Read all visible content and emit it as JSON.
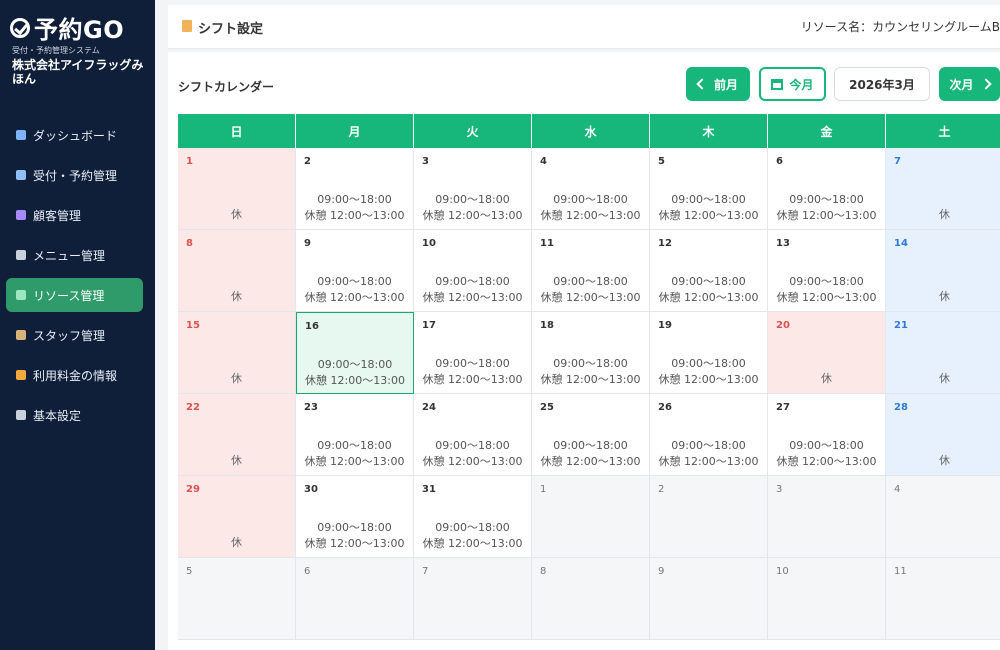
{
  "app": {
    "logo_text": "予約GO",
    "logo_sub": "受付・予約管理システム",
    "company": "株式会社アイフラッグみほん"
  },
  "sidebar": {
    "items": [
      {
        "label": "ダッシュボード",
        "icon": "chart-icon",
        "active": false
      },
      {
        "label": "受付・予約管理",
        "icon": "calendar-icon",
        "active": false
      },
      {
        "label": "顧客管理",
        "icon": "users-icon",
        "active": false
      },
      {
        "label": "メニュー管理",
        "icon": "tools-icon",
        "active": false
      },
      {
        "label": "リソース管理",
        "icon": "resource-icon",
        "active": true
      },
      {
        "label": "スタッフ管理",
        "icon": "staff-icon",
        "active": false
      },
      {
        "label": "利用料金の情報",
        "icon": "money-bag-icon",
        "active": false
      },
      {
        "label": "基本設定",
        "icon": "gear-icon",
        "active": false
      }
    ]
  },
  "header": {
    "title": "シフト設定",
    "resource": "リソース名：カウンセリングルームB"
  },
  "panel": {
    "title": "シフトカレンダー",
    "prev_label": "前月",
    "today_label": "今月",
    "current_month": "2026年3月",
    "next_label": "次月"
  },
  "calendar": {
    "weekdays": [
      "日",
      "月",
      "火",
      "水",
      "木",
      "金",
      "土"
    ],
    "work_time": "09:00〜18:00",
    "break_time": "休憩 12:00〜13:00",
    "off_label": "休",
    "cells": [
      {
        "day": "1",
        "type": "sun-off"
      },
      {
        "day": "2",
        "type": "work"
      },
      {
        "day": "3",
        "type": "work"
      },
      {
        "day": "4",
        "type": "work"
      },
      {
        "day": "5",
        "type": "work"
      },
      {
        "day": "6",
        "type": "work"
      },
      {
        "day": "7",
        "type": "sat-off"
      },
      {
        "day": "8",
        "type": "sun-off"
      },
      {
        "day": "9",
        "type": "work"
      },
      {
        "day": "10",
        "type": "work"
      },
      {
        "day": "11",
        "type": "work"
      },
      {
        "day": "12",
        "type": "work"
      },
      {
        "day": "13",
        "type": "work"
      },
      {
        "day": "14",
        "type": "sat-off"
      },
      {
        "day": "15",
        "type": "sun-off"
      },
      {
        "day": "16",
        "type": "today"
      },
      {
        "day": "17",
        "type": "work"
      },
      {
        "day": "18",
        "type": "work"
      },
      {
        "day": "19",
        "type": "work"
      },
      {
        "day": "20",
        "type": "off-pink"
      },
      {
        "day": "21",
        "type": "sat-off"
      },
      {
        "day": "22",
        "type": "sun-off"
      },
      {
        "day": "23",
        "type": "work"
      },
      {
        "day": "24",
        "type": "work"
      },
      {
        "day": "25",
        "type": "work"
      },
      {
        "day": "26",
        "type": "work"
      },
      {
        "day": "27",
        "type": "work"
      },
      {
        "day": "28",
        "type": "sat-off"
      },
      {
        "day": "29",
        "type": "sun-off"
      },
      {
        "day": "30",
        "type": "work"
      },
      {
        "day": "31",
        "type": "work"
      },
      {
        "day": "1",
        "type": "outside"
      },
      {
        "day": "2",
        "type": "outside"
      },
      {
        "day": "3",
        "type": "outside"
      },
      {
        "day": "4",
        "type": "outside"
      },
      {
        "day": "5",
        "type": "outside"
      },
      {
        "day": "6",
        "type": "outside"
      },
      {
        "day": "7",
        "type": "outside"
      },
      {
        "day": "8",
        "type": "outside"
      },
      {
        "day": "9",
        "type": "outside"
      },
      {
        "day": "10",
        "type": "outside"
      },
      {
        "day": "11",
        "type": "outside"
      }
    ]
  }
}
